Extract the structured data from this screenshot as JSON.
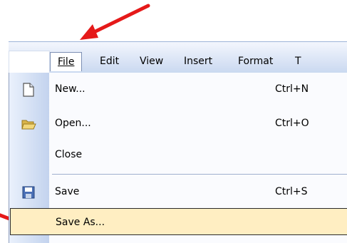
{
  "menubar": {
    "items": [
      {
        "label": "File"
      },
      {
        "label": "Edit"
      },
      {
        "label": "View"
      },
      {
        "label": "Insert"
      },
      {
        "label": "Format"
      },
      {
        "label": "T"
      }
    ]
  },
  "file_menu": {
    "items": [
      {
        "label": "New...",
        "shortcut": "Ctrl+N",
        "icon": "new-document-icon"
      },
      {
        "label": "Open...",
        "shortcut": "Ctrl+O",
        "icon": "open-folder-icon"
      },
      {
        "label": "Close",
        "shortcut": "",
        "icon": ""
      },
      {
        "label": "Save",
        "shortcut": "Ctrl+S",
        "icon": "save-disk-icon"
      },
      {
        "label": "Save As...",
        "shortcut": "",
        "icon": ""
      }
    ],
    "highlighted_item": "Save As..."
  },
  "colors": {
    "arrow": "#e51919",
    "highlight": "#ffeec2",
    "menubar_top": "#f3f6fd",
    "menubar_bottom": "#c9d8f0"
  }
}
